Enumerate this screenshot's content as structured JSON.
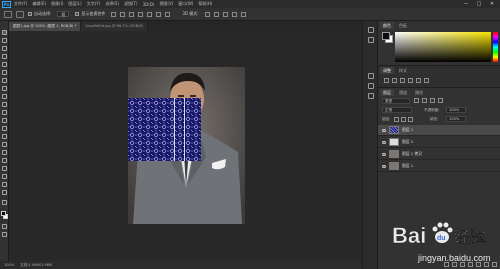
{
  "menu": {
    "logo": "Ps",
    "items": [
      "文件(F)",
      "编辑(E)",
      "图像(I)",
      "图层(L)",
      "文字(Y)",
      "选择(S)",
      "滤镜(T)",
      "3D(D)",
      "视图(V)",
      "窗口(W)",
      "帮助(H)"
    ]
  },
  "window_controls": [
    "—",
    "□",
    "✕"
  ],
  "options": {
    "auto_select_label": "自动选择:",
    "auto_select_value": "组",
    "show_transform_label": "显示变换控件",
    "mode_3d_label": "3D 模式:"
  },
  "tabs": [
    {
      "label": "图层1.jpg @ 100% (图层 1, RGB/8) *"
    },
    {
      "label": "Ungd9d0d.jpg @ 66.7% (RGB/8)"
    }
  ],
  "status": {
    "zoom": "100%",
    "doc_info": "文档:1.98M/1.98M"
  },
  "panels": {
    "color_tabs": [
      "颜色",
      "色板"
    ],
    "adjust_tabs": [
      "调整",
      "样式"
    ],
    "layers_tabs": [
      "图层",
      "通道",
      "路径"
    ],
    "kind_label": "类型",
    "blend_mode": "正常",
    "opacity_label": "不透明度:",
    "opacity_value": "100%",
    "lock_label": "锁定:",
    "fill_label": "填充:",
    "fill_value": "100%"
  },
  "layers": [
    {
      "name": "图层 1",
      "active": true
    },
    {
      "name": "图层 2"
    },
    {
      "name": "图层 1 拷贝"
    },
    {
      "name": "图层 1"
    }
  ],
  "colors": {
    "foreground": "#0b0b0b",
    "background": "#ffffff",
    "pattern_navy": "#1b1b6e",
    "accent": "#31a8ff"
  },
  "watermark": {
    "brand": "Bai",
    "paw": "du",
    "chinese": "经验",
    "url": "jingyan.baidu.com"
  }
}
